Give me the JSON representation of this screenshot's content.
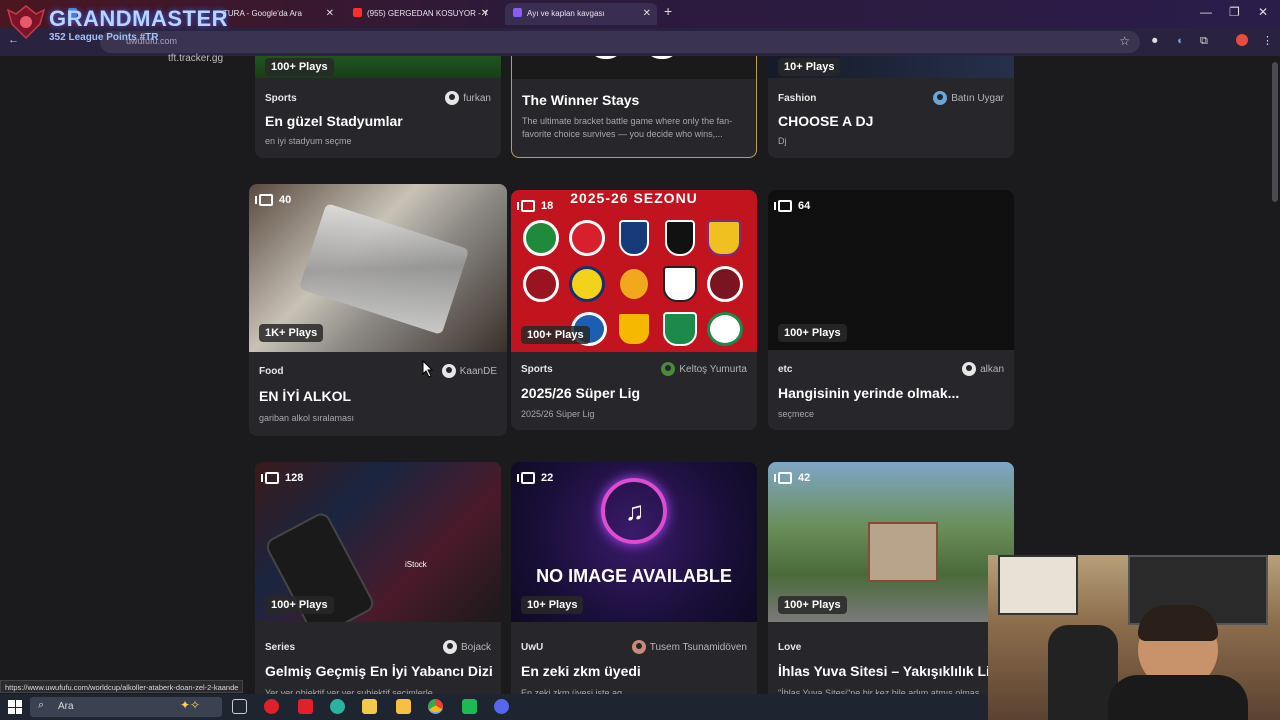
{
  "browser": {
    "tabs": [
      {
        "label": "TURA - Google'da Ara"
      },
      {
        "label": "(955) GERGEDAN KOSUYOR - Y"
      },
      {
        "label": "Ayı ve kaplan kavgası"
      }
    ],
    "url": "uwufufu.com",
    "status_url": "https://www.uwufufu.com/worldcup/alkoller-ataberk-doan-zel-2-kaande"
  },
  "overlay": {
    "title": "GRANDMASTER",
    "subtitle": "352 League Points #TR",
    "tracker": "tft.tracker.gg"
  },
  "cards": [
    {
      "plays": "100+ Plays",
      "category": "Sports",
      "author": "furkan",
      "title": "En güzel Stadyumlar",
      "desc": "en iyi stadyum seçme"
    },
    {
      "title": "The Winner Stays",
      "desc": "The ultimate bracket battle game where only the fan-favorite choice survives — you decide who wins,..."
    },
    {
      "plays": "10+ Plays",
      "category": "Fashion",
      "author": "Batın Uygar",
      "title": "CHOOSE A DJ",
      "desc": "Dj"
    },
    {
      "count": "40",
      "plays": "1K+ Plays",
      "category": "Food",
      "author": "KaanDE",
      "title": "EN İYİ ALKOL",
      "desc": "gariban alkol sıralaması"
    },
    {
      "count": "18",
      "plays": "100+ Plays",
      "category": "Sports",
      "author": "Keltoş Yumurta",
      "title": "2025/26 Süper Lig",
      "desc": "2025/26 Süper Lig",
      "banner": "2025-26 SEZONU"
    },
    {
      "count": "64",
      "plays": "100+ Plays",
      "category": "etc",
      "author": "alkan",
      "title": "Hangisinin yerinde olmak...",
      "desc": "seçmece"
    },
    {
      "count": "128",
      "plays": "100+ Plays",
      "category": "Series",
      "author": "Bojack",
      "title": "Gelmiş Geçmiş En İyi Yabancı Dizi",
      "desc": "Yer yer objektif yer yer subjektif seçimlerle...",
      "watermark": "iStock"
    },
    {
      "count": "22",
      "plays": "10+ Plays",
      "category": "UwU",
      "author": "Tusem Tsunamidöven",
      "title": "En zeki zkm üyedi",
      "desc": "En zeki zkm üyesi iste ag",
      "image_text": "NO IMAGE AVAILABLE"
    },
    {
      "count": "42",
      "plays": "100+ Plays",
      "category": "Love",
      "author": "",
      "title": "İhlas Yuva Sitesi – Yakışıklılık Lig",
      "desc": "\"İhlas Yuva Sitesi\"ne bir kez bile adım atmış olmas"
    }
  ],
  "taskbar": {
    "search_placeholder": "Ara"
  }
}
